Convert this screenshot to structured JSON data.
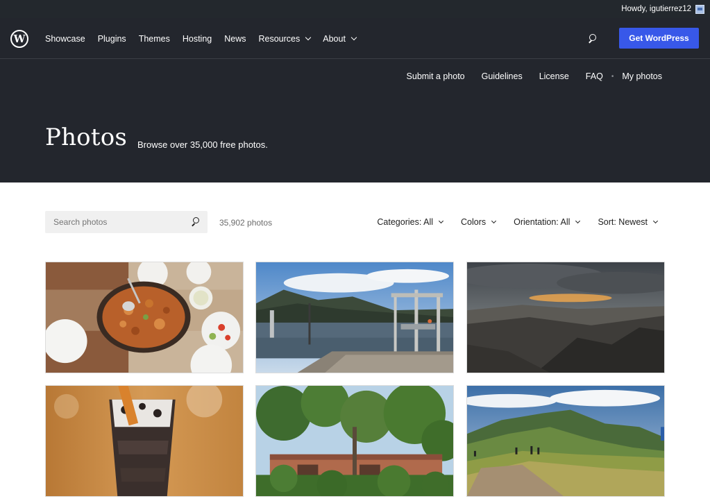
{
  "admin_bar": {
    "greeting": "Howdy, igutierrez12"
  },
  "global_nav": {
    "items": [
      {
        "label": "Showcase"
      },
      {
        "label": "Plugins"
      },
      {
        "label": "Themes"
      },
      {
        "label": "Hosting"
      },
      {
        "label": "News"
      },
      {
        "label": "Resources"
      },
      {
        "label": "About"
      }
    ],
    "cta_label": "Get WordPress",
    "accent_color": "#3858e9"
  },
  "sub_nav": {
    "items": [
      {
        "label": "Submit a photo"
      },
      {
        "label": "Guidelines"
      },
      {
        "label": "License"
      },
      {
        "label": "FAQ"
      },
      {
        "label": "My photos"
      }
    ],
    "separator": "•"
  },
  "hero": {
    "title": "Photos",
    "subtitle": "Browse over 35,000 free photos."
  },
  "search": {
    "placeholder": "Search photos"
  },
  "photo_count": "35,902 photos",
  "filters": [
    {
      "label": "Categories: All"
    },
    {
      "label": "Colors"
    },
    {
      "label": "Orientation: All"
    },
    {
      "label": "Sort: Newest"
    }
  ],
  "photos": [
    {
      "subject": "paella-dish"
    },
    {
      "subject": "lake-pier"
    },
    {
      "subject": "mountain-sunset"
    },
    {
      "subject": "iced-drink"
    },
    {
      "subject": "ruined-building-trees"
    },
    {
      "subject": "mountain-hikers"
    }
  ]
}
